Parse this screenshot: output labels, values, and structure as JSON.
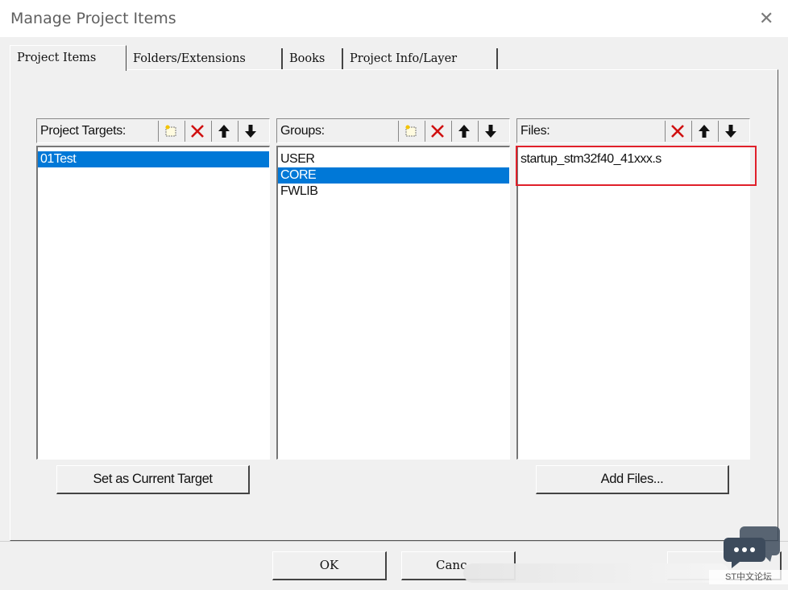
{
  "window": {
    "title": "Manage Project Items",
    "close_icon": "close-icon"
  },
  "tabs": [
    {
      "label": "Project Items",
      "active": true
    },
    {
      "label": "Folders/Extensions",
      "active": false
    },
    {
      "label": "Books",
      "active": false
    },
    {
      "label": "Project Info/Layer",
      "active": false
    }
  ],
  "targets_panel": {
    "label": "Project Targets:",
    "items": [
      "01Test"
    ],
    "selected": "01Test",
    "button_label": "Set as Current Target",
    "toolbar": [
      "new-icon",
      "delete-icon",
      "move-up-icon",
      "move-down-icon"
    ]
  },
  "groups_panel": {
    "label": "Groups:",
    "items": [
      "USER",
      "CORE",
      "FWLIB"
    ],
    "selected": "CORE",
    "toolbar": [
      "new-icon",
      "delete-icon",
      "move-up-icon",
      "move-down-icon"
    ]
  },
  "files_panel": {
    "label": "Files:",
    "items": [
      "startup_stm32f40_41xxx.s"
    ],
    "button_label": "Add Files...",
    "toolbar": [
      "delete-icon",
      "move-up-icon",
      "move-down-icon"
    ]
  },
  "footer": {
    "ok_label": "OK",
    "cancel_label": "Canc"
  },
  "watermark": {
    "text": "ST中文论坛"
  },
  "colors": {
    "selection": "#0078d7",
    "highlight_box": "#e0202a",
    "delete_icon": "#d01010"
  }
}
